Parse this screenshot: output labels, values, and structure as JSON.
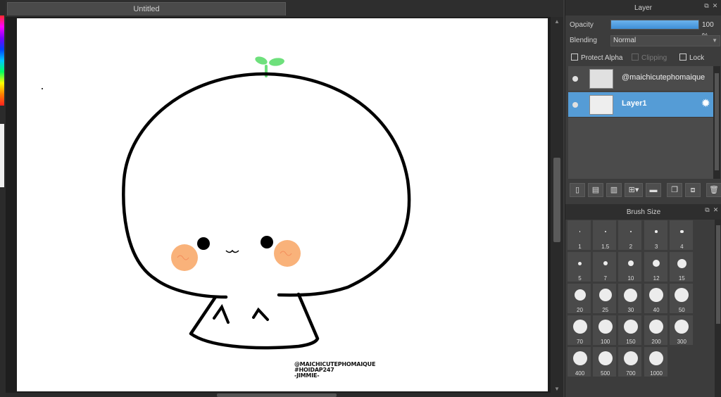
{
  "document": {
    "tab_title": "Untitled"
  },
  "canvas": {
    "signature_lines": [
      "@MAICHICUTEPHOMAIQUE",
      "#HOIDAP247",
      "-JIMMIE-"
    ],
    "colors": {
      "outline": "#000000",
      "blush": "#f9b27a",
      "sprout": "#6ee07c",
      "paper": "#ffffff"
    }
  },
  "layer_panel": {
    "title": "Layer",
    "opacity_label": "Opacity",
    "opacity_value": "100 %",
    "opacity_fraction": 1.0,
    "blending_label": "Blending",
    "blending_value": "Normal",
    "protect_alpha_label": "Protect Alpha",
    "clipping_label": "Clipping",
    "lock_label": "Lock",
    "layers": [
      {
        "name": "@maichicutephomaique",
        "selected": false
      },
      {
        "name": "Layer1",
        "selected": true
      }
    ],
    "toolbar_icons": [
      "new-layer-icon",
      "new-raster-layer-icon",
      "new-vector-layer-icon",
      "add-layer-dropdown-icon",
      "folder-icon",
      "duplicate-layer-icon",
      "merge-down-icon",
      "trash-icon"
    ]
  },
  "brush_panel": {
    "title": "Brush Size",
    "sizes": [
      "1",
      "1.5",
      "2",
      "3",
      "4",
      "5",
      "7",
      "10",
      "12",
      "15",
      "20",
      "25",
      "30",
      "40",
      "50",
      "70",
      "100",
      "150",
      "200",
      "300",
      "400",
      "500",
      "700",
      "1000"
    ]
  }
}
